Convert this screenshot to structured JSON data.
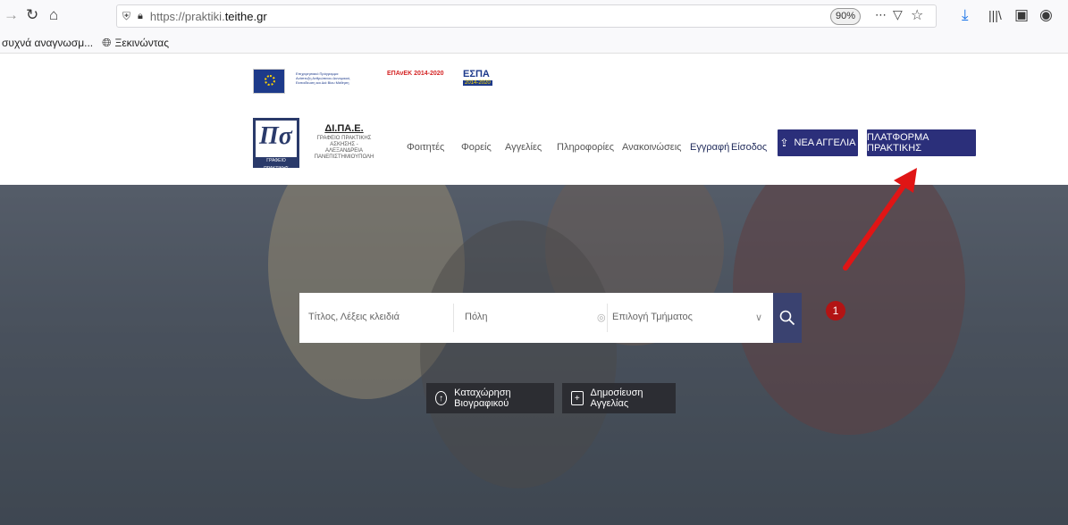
{
  "browser": {
    "url_prefix": "https://praktiki.",
    "url_domain": "teithe.gr",
    "zoom": "90%",
    "bookmarks": [
      "συχνά αναγνωσμ...",
      "Ξεκινώντας"
    ],
    "icons": [
      "forward-icon",
      "reload-icon",
      "home-icon",
      "shield-icon",
      "lock-icon",
      "more-icon",
      "pocket-icon",
      "star-icon",
      "download-icon",
      "library-icon",
      "sidebar-icon",
      "account-icon"
    ]
  },
  "banner": {
    "program": "Επιχειρησιακό Πρόγραμμα\nΑνάπτυξη Ανθρώπινου Δυναμικού,\nΕκπαίδευση και Διά Βίου Μάθηση",
    "epan": "ΕΠΑνΕΚ 2014-2020",
    "espa": "ΕΣΠΑ",
    "espa_years": "2014-2020"
  },
  "org": {
    "logo_caption": "ΓΡΑΦΕΙΟ ΠΡΑΚΤΙΚΗΣ",
    "title": "ΔΙ.ΠΑ.Ε.",
    "subtitle": "ΓΡΑΦΕΙΟ ΠΡΑΚΤΙΚΗΣ ΑΣΚΗΣΗΣ - ΑΛΕΞΑΝΔΡΕΙΑ ΠΑΝΕΠΙΣΤΗΜΙΟΥΠΟΛΗ"
  },
  "nav": {
    "students": "Φοιτητές",
    "bodies": "Φορείς",
    "ads": "Αγγελίες",
    "info": "Πληροφορίες",
    "announcements": "Ανακοινώσεις",
    "register": "Εγγραφή",
    "login": "Είσοδος",
    "new_ad": "ΝΕΑ ΑΓΓΕΛΙΑ",
    "platform": "ΠΛΑΤΦΟΡΜΑ ΠΡΑΚΤΙΚΗΣ"
  },
  "search": {
    "keywords_placeholder": "Τίτλος, Λέξεις κλειδιά",
    "city_placeholder": "Πόλη",
    "department_placeholder": "Επιλογή Τμήματος"
  },
  "annotation": {
    "marker": "1",
    "color": "#e01515"
  },
  "actions": {
    "upload_cv": "Καταχώρηση Βιογραφικού",
    "publish_ad": "Δημοσίευση Αγγελίας"
  },
  "colors": {
    "navy": "#2b2f7a",
    "search_btn": "#3a4270",
    "marker": "#b21414"
  }
}
